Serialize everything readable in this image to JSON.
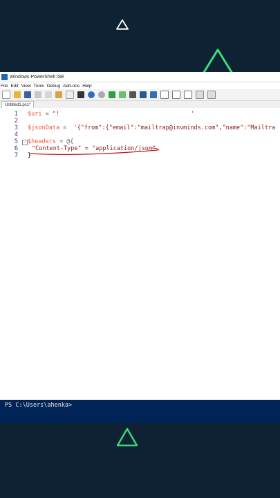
{
  "window": {
    "title": "Windows PowerShell ISE"
  },
  "menu": [
    "File",
    "Edit",
    "View",
    "Tools",
    "Debug",
    "Add-ons",
    "Help"
  ],
  "tab": {
    "label": "Untitled1.ps1*"
  },
  "editor": {
    "lines": [
      {
        "num": "1",
        "var": "$uri",
        "rest": " = ",
        "str": "\"!"
      },
      {
        "num": "2",
        "var": "",
        "rest": "",
        "str": ""
      },
      {
        "num": "3",
        "var": "$jsonData",
        "rest": " =  ",
        "str": "'{\"from\":{\"email\":\"mailtrap@invminds.com\",\"name\":\"Mailtra"
      },
      {
        "num": "4",
        "var": "",
        "rest": "",
        "str": ""
      },
      {
        "num": "5",
        "var": "$headers",
        "rest": " = @{",
        "str": ""
      },
      {
        "num": "6",
        "var": "",
        "rest": "",
        "str": "\"Content-Type\" = \"application/json\""
      },
      {
        "num": "7",
        "var": "",
        "rest": "}",
        "str": ""
      }
    ],
    "line1_tail": "'"
  },
  "console": {
    "prompt": "PS C:\\Users\\ahenka>"
  },
  "colors": {
    "background": "#0f2233",
    "console": "#012456",
    "annotation": "#c0131a",
    "triangle_green": "#3fdc7a"
  }
}
